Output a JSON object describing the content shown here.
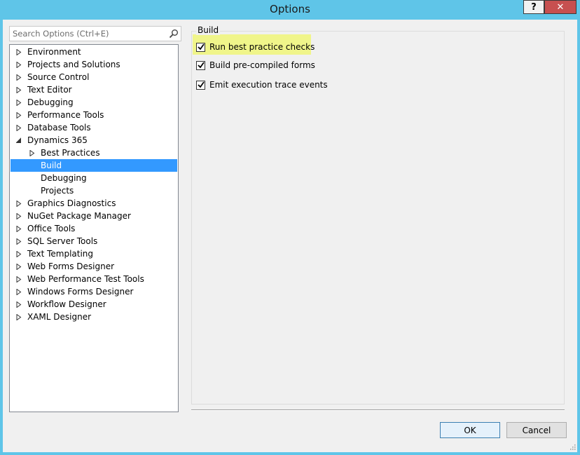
{
  "window": {
    "title": "Options",
    "help_label": "?",
    "close_label": "✕"
  },
  "search": {
    "placeholder": "Search Options (Ctrl+E)",
    "value": ""
  },
  "tree": {
    "items": [
      {
        "label": "Environment",
        "level": 0,
        "expander": "collapsed"
      },
      {
        "label": "Projects and Solutions",
        "level": 0,
        "expander": "collapsed"
      },
      {
        "label": "Source Control",
        "level": 0,
        "expander": "collapsed"
      },
      {
        "label": "Text Editor",
        "level": 0,
        "expander": "collapsed"
      },
      {
        "label": "Debugging",
        "level": 0,
        "expander": "collapsed"
      },
      {
        "label": "Performance Tools",
        "level": 0,
        "expander": "collapsed"
      },
      {
        "label": "Database Tools",
        "level": 0,
        "expander": "collapsed"
      },
      {
        "label": "Dynamics 365",
        "level": 0,
        "expander": "expanded"
      },
      {
        "label": "Best Practices",
        "level": 1,
        "expander": "collapsed"
      },
      {
        "label": "Build",
        "level": 1,
        "expander": "none",
        "selected": true
      },
      {
        "label": "Debugging",
        "level": 1,
        "expander": "none"
      },
      {
        "label": "Projects",
        "level": 1,
        "expander": "none"
      },
      {
        "label": "Graphics Diagnostics",
        "level": 0,
        "expander": "collapsed"
      },
      {
        "label": "NuGet Package Manager",
        "level": 0,
        "expander": "collapsed"
      },
      {
        "label": "Office Tools",
        "level": 0,
        "expander": "collapsed"
      },
      {
        "label": "SQL Server Tools",
        "level": 0,
        "expander": "collapsed"
      },
      {
        "label": "Text Templating",
        "level": 0,
        "expander": "collapsed"
      },
      {
        "label": "Web Forms Designer",
        "level": 0,
        "expander": "collapsed"
      },
      {
        "label": "Web Performance Test Tools",
        "level": 0,
        "expander": "collapsed"
      },
      {
        "label": "Windows Forms Designer",
        "level": 0,
        "expander": "collapsed"
      },
      {
        "label": "Workflow Designer",
        "level": 0,
        "expander": "collapsed"
      },
      {
        "label": "XAML Designer",
        "level": 0,
        "expander": "collapsed"
      }
    ]
  },
  "panel": {
    "group_title": "Build",
    "options": [
      {
        "label": "Run best practice checks",
        "checked": true,
        "highlighted": true
      },
      {
        "label": "Build pre-compiled forms",
        "checked": true
      },
      {
        "label": "Emit execution trace events",
        "checked": true
      }
    ]
  },
  "buttons": {
    "ok_label": "OK",
    "cancel_label": "Cancel"
  },
  "colors": {
    "titlebar": "#5fc5e8",
    "selection": "#3399ff",
    "highlight": "#f0f58a",
    "close": "#c75050"
  }
}
